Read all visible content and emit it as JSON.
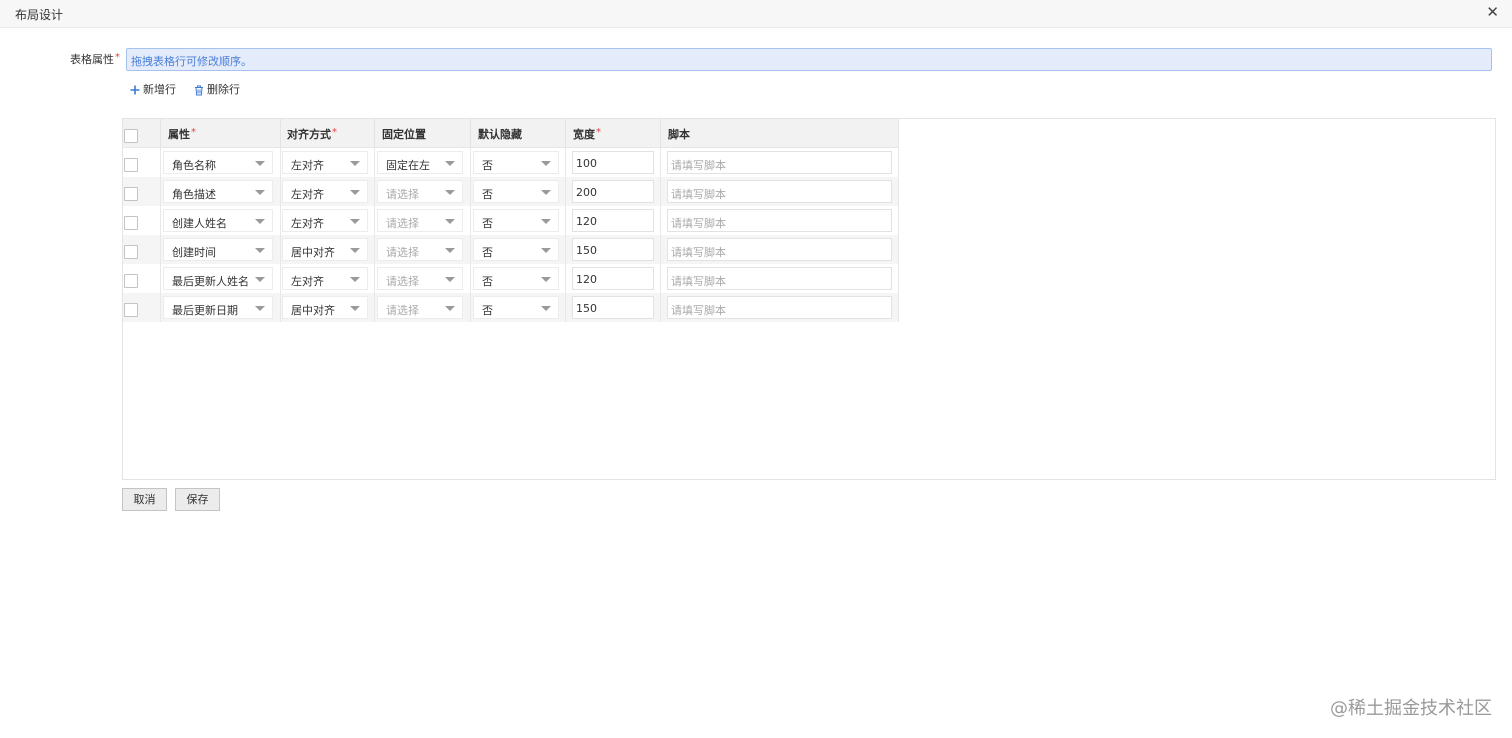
{
  "window": {
    "title": "布局设计",
    "close_glyph": "✕"
  },
  "form": {
    "label": "表格属性",
    "required_mark": "*",
    "hint": "拖拽表格行可修改顺序。"
  },
  "toolbar": {
    "add_label": "新增行",
    "delete_label": "删除行"
  },
  "table": {
    "headers": {
      "attribute": "属性",
      "align": "对齐方式",
      "fixed": "固定位置",
      "hidden": "默认隐藏",
      "width": "宽度",
      "script": "脚本"
    },
    "required_mark": "*",
    "script_placeholder": "请填写脚本",
    "rows": [
      {
        "attribute": "角色名称",
        "align": "左对齐",
        "fixed": "固定在左",
        "hidden": "否",
        "width": "100"
      },
      {
        "attribute": "角色描述",
        "align": "左对齐",
        "fixed": "请选择",
        "hidden": "否",
        "width": "200"
      },
      {
        "attribute": "创建人姓名",
        "align": "左对齐",
        "fixed": "请选择",
        "hidden": "否",
        "width": "120"
      },
      {
        "attribute": "创建时间",
        "align": "居中对齐",
        "fixed": "请选择",
        "hidden": "否",
        "width": "150"
      },
      {
        "attribute": "最后更新人姓名",
        "align": "左对齐",
        "fixed": "请选择",
        "hidden": "否",
        "width": "120"
      },
      {
        "attribute": "最后更新日期",
        "align": "居中对齐",
        "fixed": "请选择",
        "hidden": "否",
        "width": "150"
      }
    ]
  },
  "buttons": {
    "cancel": "取消",
    "save": "保存"
  },
  "watermark": "@稀土掘金技术社区",
  "colors": {
    "accent": "#4a7ed9",
    "hint_bg": "#e4ebfa",
    "required": "#e04343"
  }
}
